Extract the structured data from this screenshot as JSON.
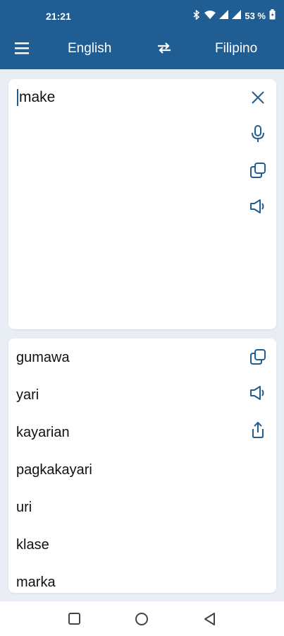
{
  "status": {
    "time": "21:21",
    "battery": "53 %",
    "icons": [
      "bluetooth-icon",
      "wifi-icon",
      "signal-icon",
      "signal-icon",
      "battery-icon"
    ]
  },
  "appbar": {
    "source_language": "English",
    "target_language": "Filipino",
    "menu_icon": "menu-icon",
    "swap_icon": "swap-icon"
  },
  "input": {
    "text": "make",
    "actions": [
      "clear-icon",
      "microphone-icon",
      "copy-icon",
      "speaker-icon"
    ]
  },
  "results": {
    "items": [
      "gumawa",
      "yari",
      "kayarian",
      "pagkakayari",
      "uri",
      "klase",
      "marka"
    ],
    "actions": [
      "copy-icon",
      "speaker-icon",
      "share-icon"
    ]
  },
  "navbar": {
    "buttons": [
      "recents-icon",
      "home-icon",
      "back-icon"
    ]
  },
  "colors": {
    "primary": "#1f5d93",
    "background": "#e9eef5",
    "icon": "#1f5d93"
  }
}
